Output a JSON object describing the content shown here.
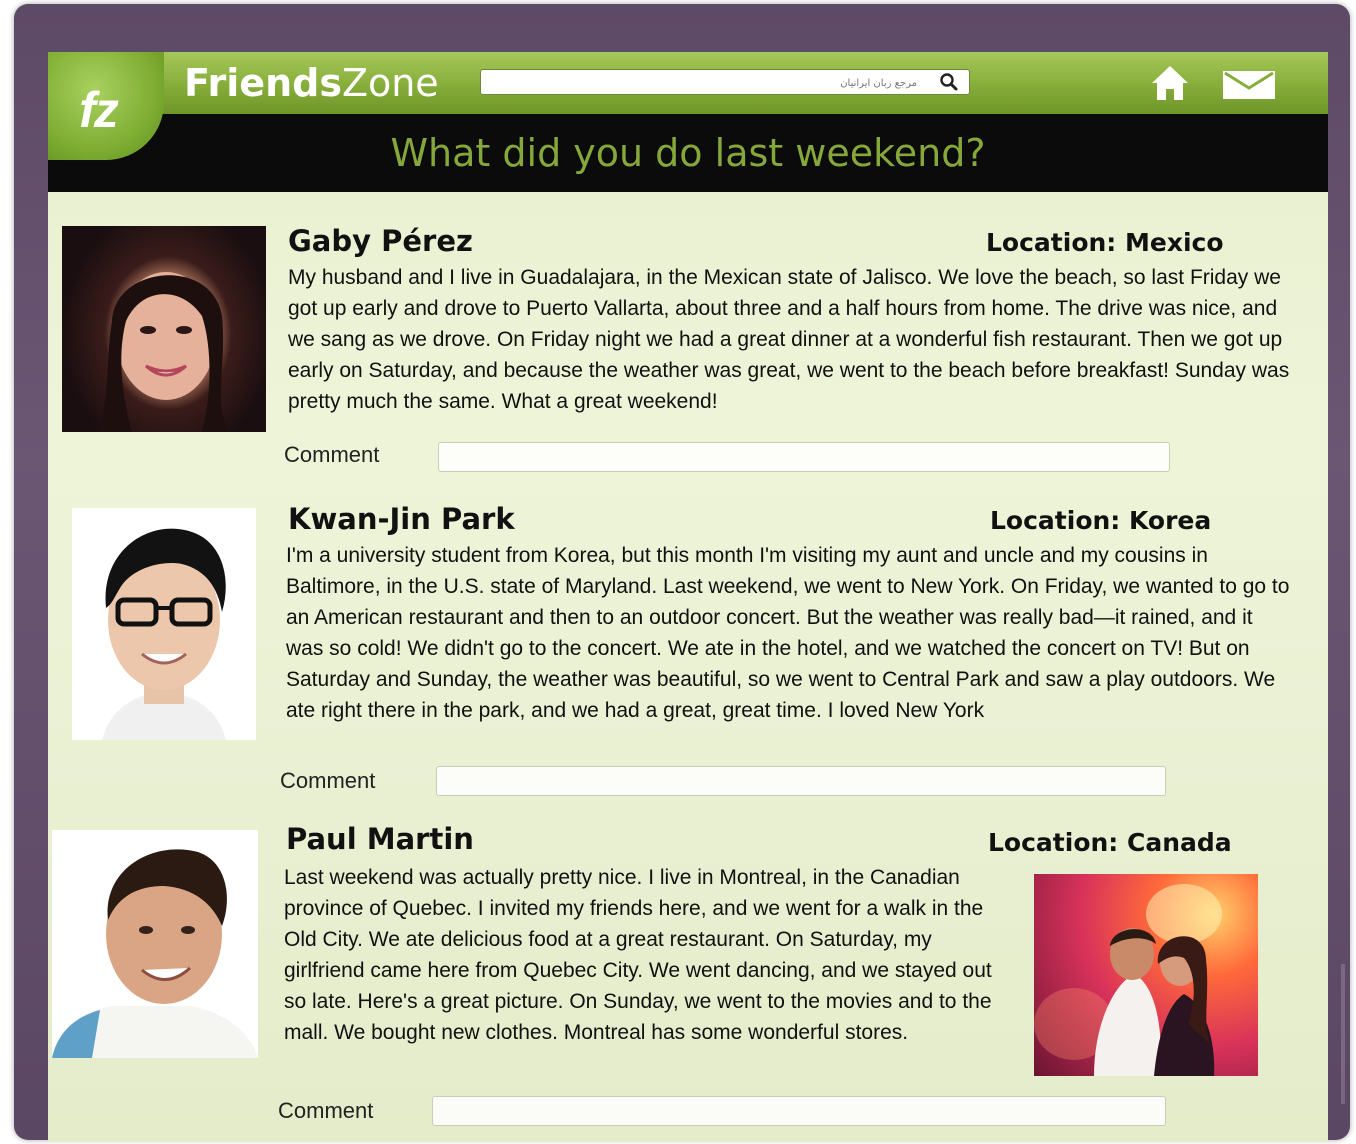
{
  "app": {
    "name_bold": "Friends",
    "name_light": "Zone",
    "logo_text": "fz"
  },
  "search": {
    "placeholder": "مرجع زبان ایرانیان"
  },
  "headline": "What did you do last weekend?",
  "colors": {
    "brand_green": "#86ad3a",
    "headline_green": "#86a83a",
    "frame_purple": "#5d4a66",
    "screen_bg": "#eef4d8"
  },
  "icons": {
    "search": "search-icon",
    "home": "home-icon",
    "mail": "mail-icon"
  },
  "posts": [
    {
      "name": "Gaby Pérez",
      "location": "Location: Mexico",
      "text": "My husband and I live in Guadalajara, in the Mexican state of Jalisco. We love the beach, so last Friday we got up early and drove to Puerto Vallarta, about three and a half hours from home. The drive was nice, and we sang as we drove. On Friday night we had a great dinner at a wonderful fish restaurant. Then we got up early on Saturday, and because the weather was great, we went to the beach before breakfast! Sunday was pretty much the same. What a great weekend!",
      "comment_label": "Comment"
    },
    {
      "name": "Kwan-Jin Park",
      "location": "Location: Korea",
      "text": "I'm a university student from Korea, but this month I'm visiting my aunt and uncle and my cousins in Baltimore, in the U.S. state of Maryland. Last weekend, we went to New York. On Friday, we wanted to go to an American restaurant and then to an outdoor concert. But the weather was really bad—it rained, and it was so cold! We didn't go to the concert. We ate in the hotel, and we watched the concert on TV! But on Saturday and Sunday, the weather was beautiful, so we went to Central Park and saw a play outdoors. We ate right there in the park, and we had a great, great time. I loved New York",
      "comment_label": "Comment"
    },
    {
      "name": "Paul Martin",
      "location": "Location: Canada",
      "text": "Last weekend was actually pretty nice. I live in Montreal, in the Canadian province of Quebec. I invited my friends here, and we went for a walk in the Old City. We ate delicious food at a great restaurant. On Saturday, my girlfriend came here from Quebec City. We went dancing, and we stayed out so late. Here's a great picture. On Sunday, we went to the movies and to the mall. We bought new clothes. Montreal has some wonderful stores.",
      "comment_label": "Comment"
    }
  ]
}
